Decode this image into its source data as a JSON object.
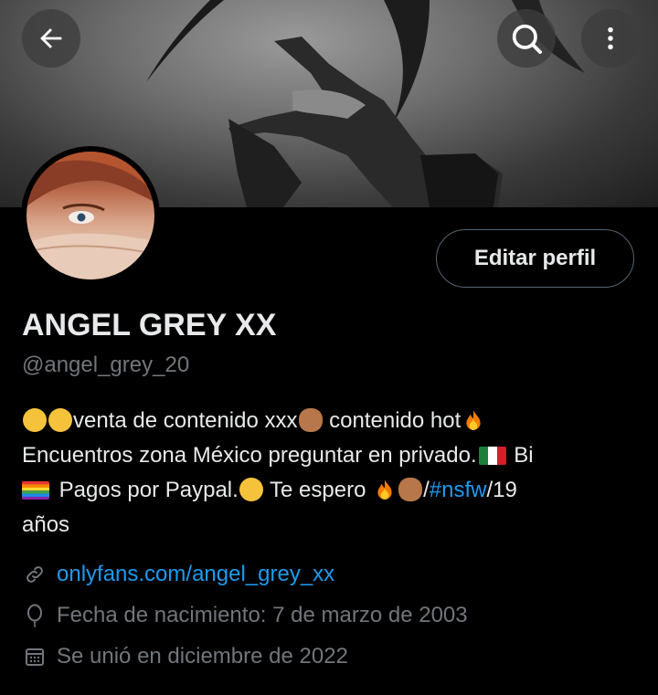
{
  "profile": {
    "name": "ANGEL GREY XX",
    "handle": "@angel_grey_20",
    "edit_button": "Editar perfil",
    "bio": {
      "line1_a": "venta de contenido xxx",
      "line1_b": " contenido hot",
      "line2": "Encuentros zona México preguntar en privado.",
      "line2_b": " Bi",
      "line3_a": " Pagos por Paypal.",
      "line3_b": " Te espero ",
      "line3_c": "/",
      "line3_tag": "#nsfw",
      "line3_d": "/19",
      "line4": "años"
    },
    "website": "onlyfans.com/angel_grey_xx",
    "birthday": "Fecha de nacimiento: 7 de marzo de 2003",
    "joined": "Se unió en diciembre de 2022"
  },
  "colors": {
    "background": "#000000",
    "text": "#e7e9ea",
    "secondary": "#71767b",
    "link": "#1d9bf0"
  },
  "icons": [
    "back-arrow-icon",
    "search-icon",
    "more-vertical-icon",
    "link-icon",
    "balloon-icon",
    "calendar-icon"
  ]
}
